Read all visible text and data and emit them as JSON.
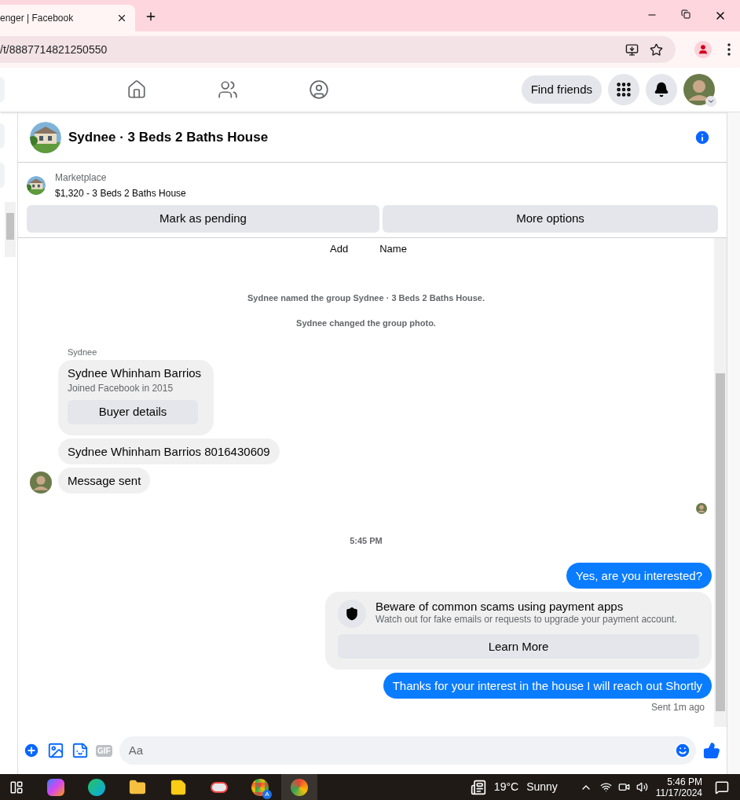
{
  "browser": {
    "tab_title": "enger | Facebook",
    "url": "/t/8887714821250550"
  },
  "nav": {
    "find_friends": "Find friends"
  },
  "chat": {
    "title": "Sydnee · 3 Beds 2 Baths House"
  },
  "listing": {
    "label": "Marketplace",
    "title": "$1,320 - 3 Beds 2 Baths House",
    "buttons": [
      "Mark as pending",
      "More options"
    ]
  },
  "messages": [
    {
      "kind": "tabs",
      "labels": [
        "Add",
        "Name"
      ]
    },
    {
      "kind": "notice",
      "text": "Sydnee named the group Sydnee · 3 Beds 2 Baths House."
    },
    {
      "kind": "notice",
      "text": "Sydnee changed the group photo."
    },
    {
      "kind": "sender",
      "text": "Sydnee"
    },
    {
      "kind": "card",
      "name": "Sydnee Whinham Barrios",
      "detail": "Joined Facebook in 2015",
      "button": "Buyer details"
    },
    {
      "kind": "incoming",
      "text": "Sydnee Whinham Barrios 8016430609",
      "avatar": false
    },
    {
      "kind": "incoming",
      "text": "Message sent",
      "avatar": true
    },
    {
      "kind": "seen"
    },
    {
      "kind": "time",
      "text": "5:45 PM"
    },
    {
      "kind": "outgoing",
      "text": "Yes, are you interested?"
    },
    {
      "kind": "warning",
      "title": "Beware of common scams using payment apps",
      "text": "Watch out for fake emails or requests to upgrade your payment account.",
      "button": "Learn More"
    },
    {
      "kind": "outgoing",
      "text": "Thanks for your interest in the house I will reach out Shortly"
    },
    {
      "kind": "status",
      "text": "Sent 1m ago"
    }
  ],
  "composer": {
    "gif": "GIF",
    "placeholder": "Aa"
  },
  "taskbar": {
    "badge": "A",
    "temperature": "19°C",
    "weather": "Sunny",
    "time": "5:46 PM",
    "date": "11/17/2024"
  }
}
